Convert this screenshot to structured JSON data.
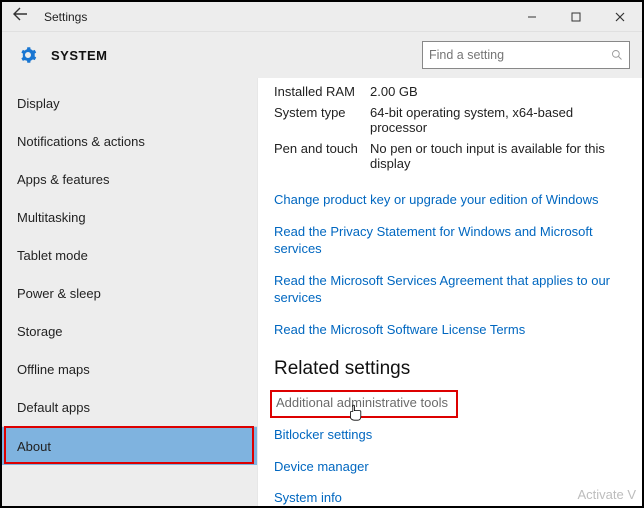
{
  "window": {
    "title": "Settings"
  },
  "header": {
    "section": "SYSTEM",
    "search_placeholder": "Find a setting"
  },
  "sidebar": {
    "items": [
      {
        "label": "Display"
      },
      {
        "label": "Notifications & actions"
      },
      {
        "label": "Apps & features"
      },
      {
        "label": "Multitasking"
      },
      {
        "label": "Tablet mode"
      },
      {
        "label": "Power & sleep"
      },
      {
        "label": "Storage"
      },
      {
        "label": "Offline maps"
      },
      {
        "label": "Default apps"
      },
      {
        "label": "About"
      }
    ]
  },
  "specs": {
    "ram_label": "Installed RAM",
    "ram_value": "2.00 GB",
    "systype_label": "System type",
    "systype_value": "64-bit operating system, x64-based processor",
    "pen_label": "Pen and touch",
    "pen_value": "No pen or touch input is available for this display"
  },
  "links": {
    "change_key": "Change product key or upgrade your edition of Windows",
    "privacy": "Read the Privacy Statement for Windows and Microsoft services",
    "agreement": "Read the Microsoft Services Agreement that applies to our services",
    "license": "Read the Microsoft Software License Terms"
  },
  "related": {
    "heading": "Related settings",
    "admin": "Additional administrative tools",
    "bitlocker": "Bitlocker settings",
    "devmgr": "Device manager",
    "sysinfo": "System info"
  },
  "watermark": "Activate V"
}
